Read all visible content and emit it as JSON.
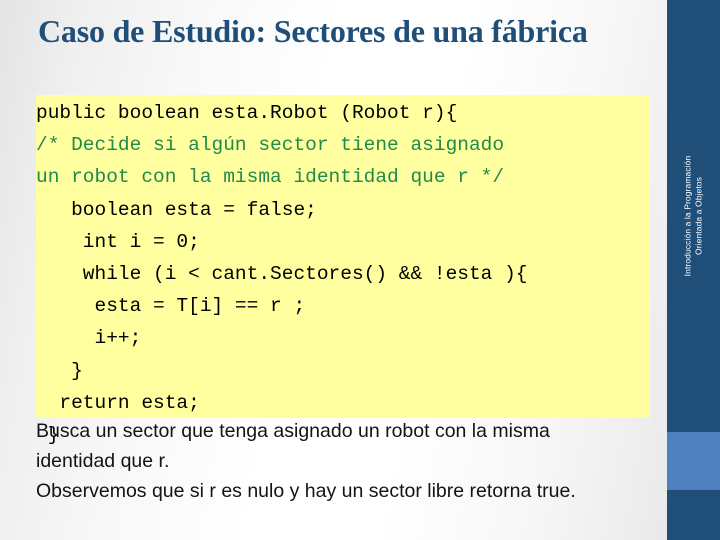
{
  "slide": {
    "title": "Caso de Estudio: Sectores de una fábrica",
    "colors": {
      "title_blue": "#1f4e79",
      "sidebar_dark": "#1f4e79",
      "sidebar_light": "#4e80bf",
      "code_background": "#ffffa0",
      "code_text": "#000000",
      "code_comment_green": "#1f8a4c",
      "body_text": "#141414"
    }
  },
  "code": {
    "lines": [
      {
        "text": "public boolean esta.Robot (Robot r){",
        "style": "code"
      },
      {
        "text": "/* Decide si algún sector tiene asignado",
        "style": "comment"
      },
      {
        "text": "un robot con la misma identidad que r */",
        "style": "comment"
      },
      {
        "text": "   boolean esta = false;",
        "style": "code"
      },
      {
        "text": "    int i = 0;",
        "style": "code"
      },
      {
        "text": "    while (i < cant.Sectores() && !esta ){",
        "style": "code"
      },
      {
        "text": "     esta = T[i] == r ;",
        "style": "code"
      },
      {
        "text": "     i++;",
        "style": "code"
      },
      {
        "text": "   }",
        "style": "code"
      },
      {
        "text": "  return esta;",
        "style": "code"
      },
      {
        "text": " }",
        "style": "code"
      }
    ]
  },
  "body": {
    "lines": [
      "Busca un sector que tenga asignado un robot con la misma",
      "identidad que r.",
      "Observemos que si r es nulo y hay un sector libre retorna true."
    ]
  },
  "sidebar": {
    "label_line1": "Introducción a la Programación",
    "label_line2": "Orientada a Objetos"
  }
}
